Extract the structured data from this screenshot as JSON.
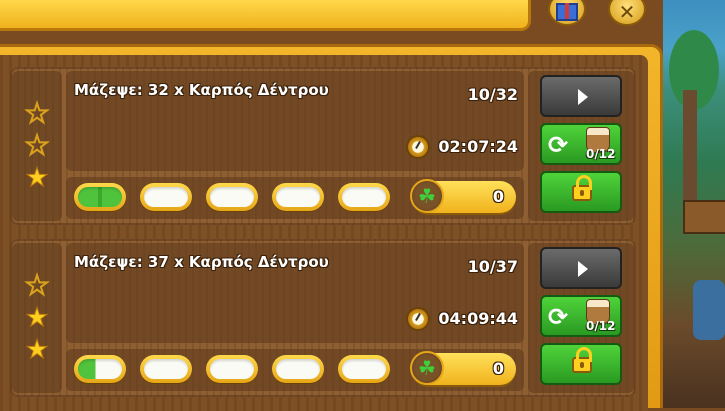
{
  "top": {
    "gift_icon": "gift-icon",
    "close_icon": "close-icon",
    "close_glyph": "✕"
  },
  "tasks": [
    {
      "title": "Μάζεψε: 32 x Καρπός Δέντρου",
      "progress": "10/32",
      "timer": "02:07:24",
      "stars": [
        "empty",
        "empty",
        "full"
      ],
      "slots": [
        "half-green",
        "empty",
        "empty",
        "empty",
        "empty"
      ],
      "clover_count": "0",
      "refresh_count": "0/12"
    },
    {
      "title": "Μάζεψε: 37 x Καρπός Δέντρου",
      "progress": "10/37",
      "timer": "04:09:44",
      "stars": [
        "empty",
        "full",
        "full"
      ],
      "slots": [
        "partial-green",
        "empty",
        "empty",
        "empty",
        "empty"
      ],
      "clover_count": "0",
      "refresh_count": "0/12"
    }
  ],
  "colors": {
    "panel_gold": "#f0b21c",
    "wood": "#7b4c22",
    "green_button": "#2fa22a",
    "dark_button": "#3a3a3a"
  }
}
